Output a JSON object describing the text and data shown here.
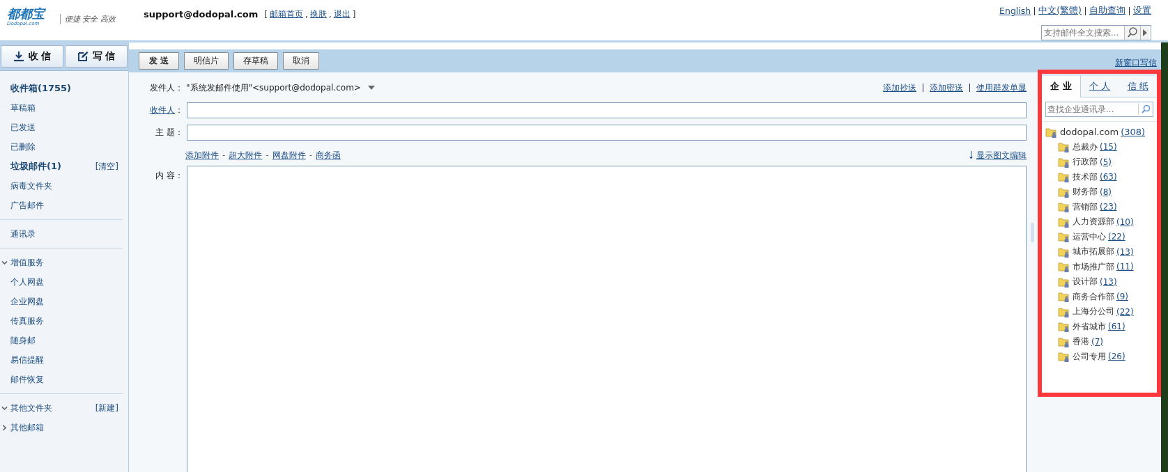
{
  "header": {
    "logo_text": "都都宝",
    "logo_sub": "Dodopal.com",
    "slogan": "便捷 安全 高效",
    "account": "support@dodopal.com",
    "account_links": [
      "邮箱首页",
      "换肤",
      "退出"
    ],
    "account_brackets": [
      "[",
      "]"
    ],
    "account_separator": ",",
    "top_links": [
      "English",
      "中文(繁體)",
      "自助查询",
      "设置"
    ],
    "search": {
      "placeholder": "支持邮件全文搜索..."
    }
  },
  "sidebar": {
    "buttons": [
      {
        "label": "收 信",
        "kind": "receive"
      },
      {
        "label": "写 信",
        "kind": "compose"
      }
    ],
    "groups": [
      {
        "kind": "folders",
        "items": [
          {
            "label": "收件箱(1755)",
            "unread": true
          },
          {
            "label": "草稿箱",
            "unread": false
          },
          {
            "label": "已发送",
            "unread": false
          },
          {
            "label": "已删除",
            "unread": false
          },
          {
            "label": "垃圾邮件(1)",
            "unread": true,
            "action": "[清空]"
          },
          {
            "label": "病毒文件夹",
            "unread": false
          },
          {
            "label": "广告邮件",
            "unread": false
          }
        ]
      },
      {
        "kind": "folders",
        "items": [
          {
            "label": "通讯录",
            "unread": false
          }
        ]
      },
      {
        "kind": "sections",
        "items": [
          {
            "label": "增值服务",
            "expanded": true,
            "children": [
              {
                "label": "个人网盘"
              },
              {
                "label": "企业网盘"
              },
              {
                "label": "传真服务"
              },
              {
                "label": "随身邮"
              },
              {
                "label": "易信提醒"
              },
              {
                "label": "邮件恢复"
              }
            ]
          }
        ]
      },
      {
        "kind": "sections",
        "items": [
          {
            "label": "其他文件夹",
            "expanded": true,
            "action": "[新建]"
          },
          {
            "label": "其他邮箱",
            "expanded": false
          }
        ]
      }
    ]
  },
  "compose": {
    "toolbar": [
      "发 送",
      "明信片",
      "存草稿",
      "取消"
    ],
    "new_window_link": "新窗口写信",
    "sender_label": "发件人：",
    "sender_value": "\"系统发邮件使用\"<support@dodopal.com>",
    "cc_links": [
      "添加抄送",
      "添加密送",
      "使用群发单显"
    ],
    "recipient_label": "收件人",
    "recipient_colon": "：",
    "subject_label": "主 题：",
    "attachment_links": [
      "添加附件",
      "超大附件",
      "网盘附件",
      "商务函"
    ],
    "attachment_separator": "-",
    "rich_edit_link": "显示图文编辑",
    "content_label": "内 容："
  },
  "contacts": {
    "highlighted": true,
    "tabs": [
      {
        "label": "企 业",
        "selected": true
      },
      {
        "label": "个 人",
        "selected": false
      },
      {
        "label": "信 纸",
        "selected": false
      }
    ],
    "search": {
      "placeholder": "查找企业通讯录..."
    },
    "tree": [
      {
        "name": "dodopal.com",
        "count": "(308)",
        "children": [
          {
            "name": "总裁办",
            "count": "(15)"
          },
          {
            "name": "行政部",
            "count": "(5)"
          },
          {
            "name": "技术部",
            "count": "(63)"
          },
          {
            "name": "财务部",
            "count": "(8)"
          },
          {
            "name": "营销部",
            "count": "(23)"
          },
          {
            "name": "人力资源部",
            "count": "(10)"
          },
          {
            "name": "运营中心",
            "count": "(22)"
          },
          {
            "name": "城市拓展部",
            "count": "(13)"
          },
          {
            "name": "市场推广部",
            "count": "(11)"
          },
          {
            "name": "设计部",
            "count": "(13)"
          },
          {
            "name": "商务合作部",
            "count": "(9)"
          },
          {
            "name": "上海分公司",
            "count": "(22)"
          },
          {
            "name": "外省城市",
            "count": "(61)"
          },
          {
            "name": "香港",
            "count": "(7)"
          },
          {
            "name": "公司专用",
            "count": "(26)"
          }
        ]
      }
    ]
  }
}
